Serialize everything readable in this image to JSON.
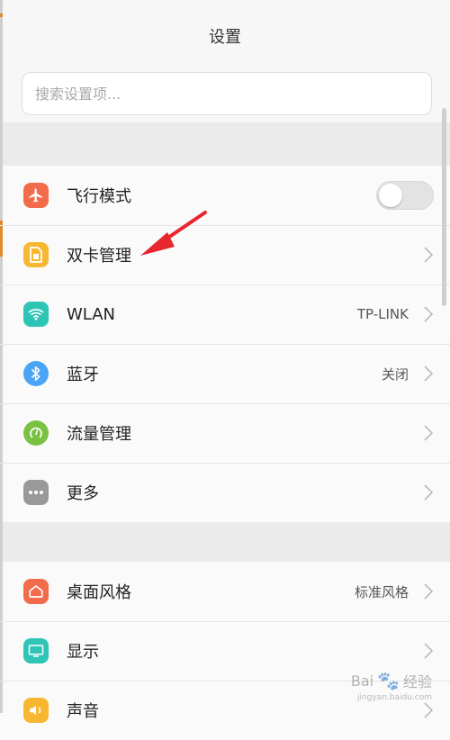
{
  "header": {
    "title": "设置"
  },
  "search": {
    "placeholder": "搜索设置项..."
  },
  "section1": [
    {
      "label": "飞行模式",
      "icon": "airplane-icon",
      "color": "#f26b4a",
      "control": "toggle",
      "toggle_on": false
    },
    {
      "label": "双卡管理",
      "icon": "sim-card-icon",
      "color": "#f7b731",
      "control": "chevron"
    },
    {
      "label": "WLAN",
      "icon": "wifi-icon",
      "color": "#2ec4b6",
      "value": "TP-LINK",
      "control": "chevron"
    },
    {
      "label": "蓝牙",
      "icon": "bluetooth-icon",
      "color": "#4aa6f5",
      "value": "关闭",
      "control": "chevron"
    },
    {
      "label": "流量管理",
      "icon": "data-usage-icon",
      "color": "#7ac143",
      "control": "chevron"
    },
    {
      "label": "更多",
      "icon": "more-icon",
      "color": "#9a9a9a",
      "control": "chevron"
    }
  ],
  "section2": [
    {
      "label": "桌面风格",
      "icon": "home-icon",
      "color": "#f26b4a",
      "value": "标准风格",
      "control": "chevron"
    },
    {
      "label": "显示",
      "icon": "display-icon",
      "color": "#2ec4b6",
      "control": "chevron"
    },
    {
      "label": "声音",
      "icon": "sound-icon",
      "color": "#f7b731",
      "control": "chevron"
    }
  ],
  "watermark": {
    "text": "Bai",
    "text2": "经验",
    "sub": "jingyan.baidu.com"
  }
}
